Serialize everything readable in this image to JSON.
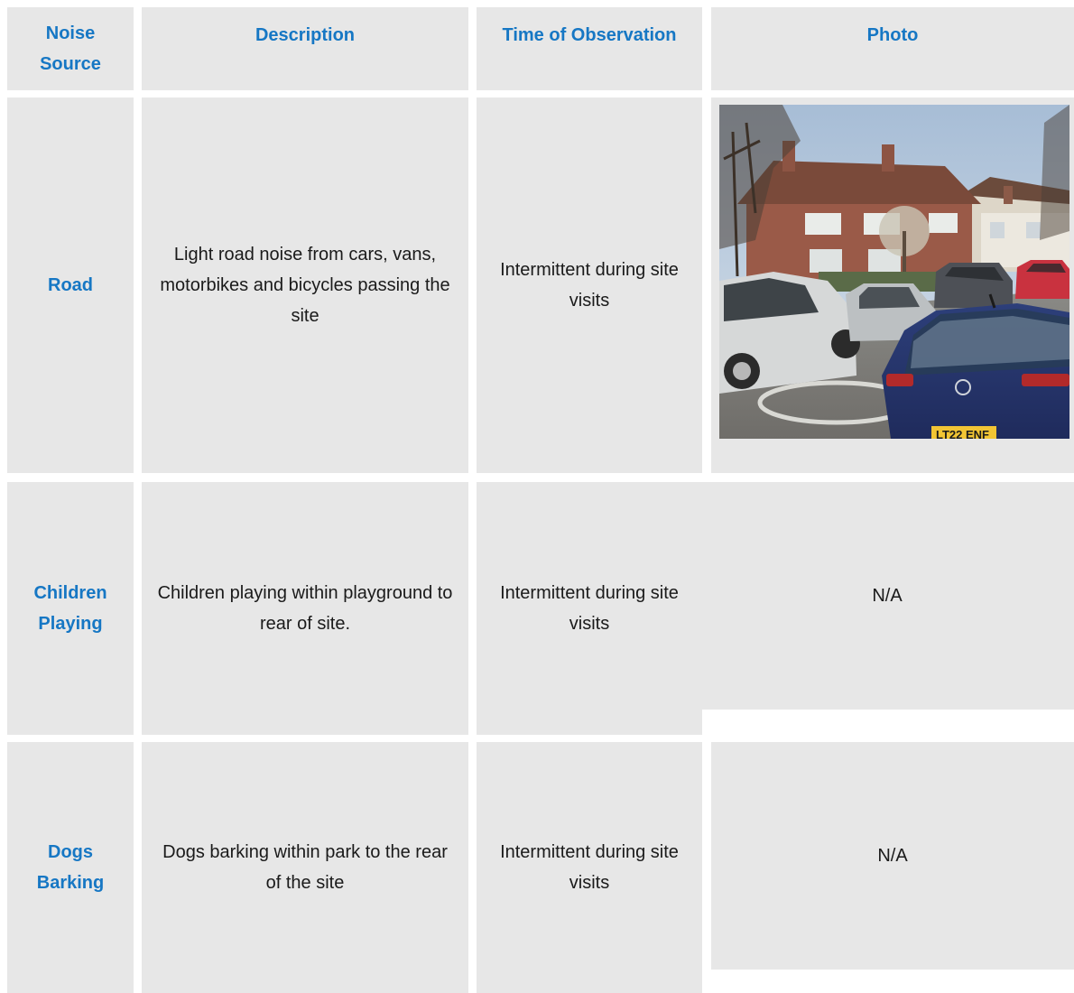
{
  "headers": {
    "source": "Noise Source",
    "description": "Description",
    "time": "Time of Observation",
    "photo": "Photo"
  },
  "rows": [
    {
      "source": "Road",
      "description": "Light road noise from cars, vans, motorbikes and bicycles passing the site",
      "time": "Intermittent during site visits",
      "photo": "",
      "plate": "LT22 ENF"
    },
    {
      "source": "Children Playing",
      "description": "Children playing within playground to rear of site.",
      "time": "Intermittent during site visits",
      "photo": "N/A"
    },
    {
      "source": "Dogs Barking",
      "description": "Dogs barking within park to the rear of the site",
      "time": "Intermittent during site visits",
      "photo": "N/A"
    }
  ]
}
